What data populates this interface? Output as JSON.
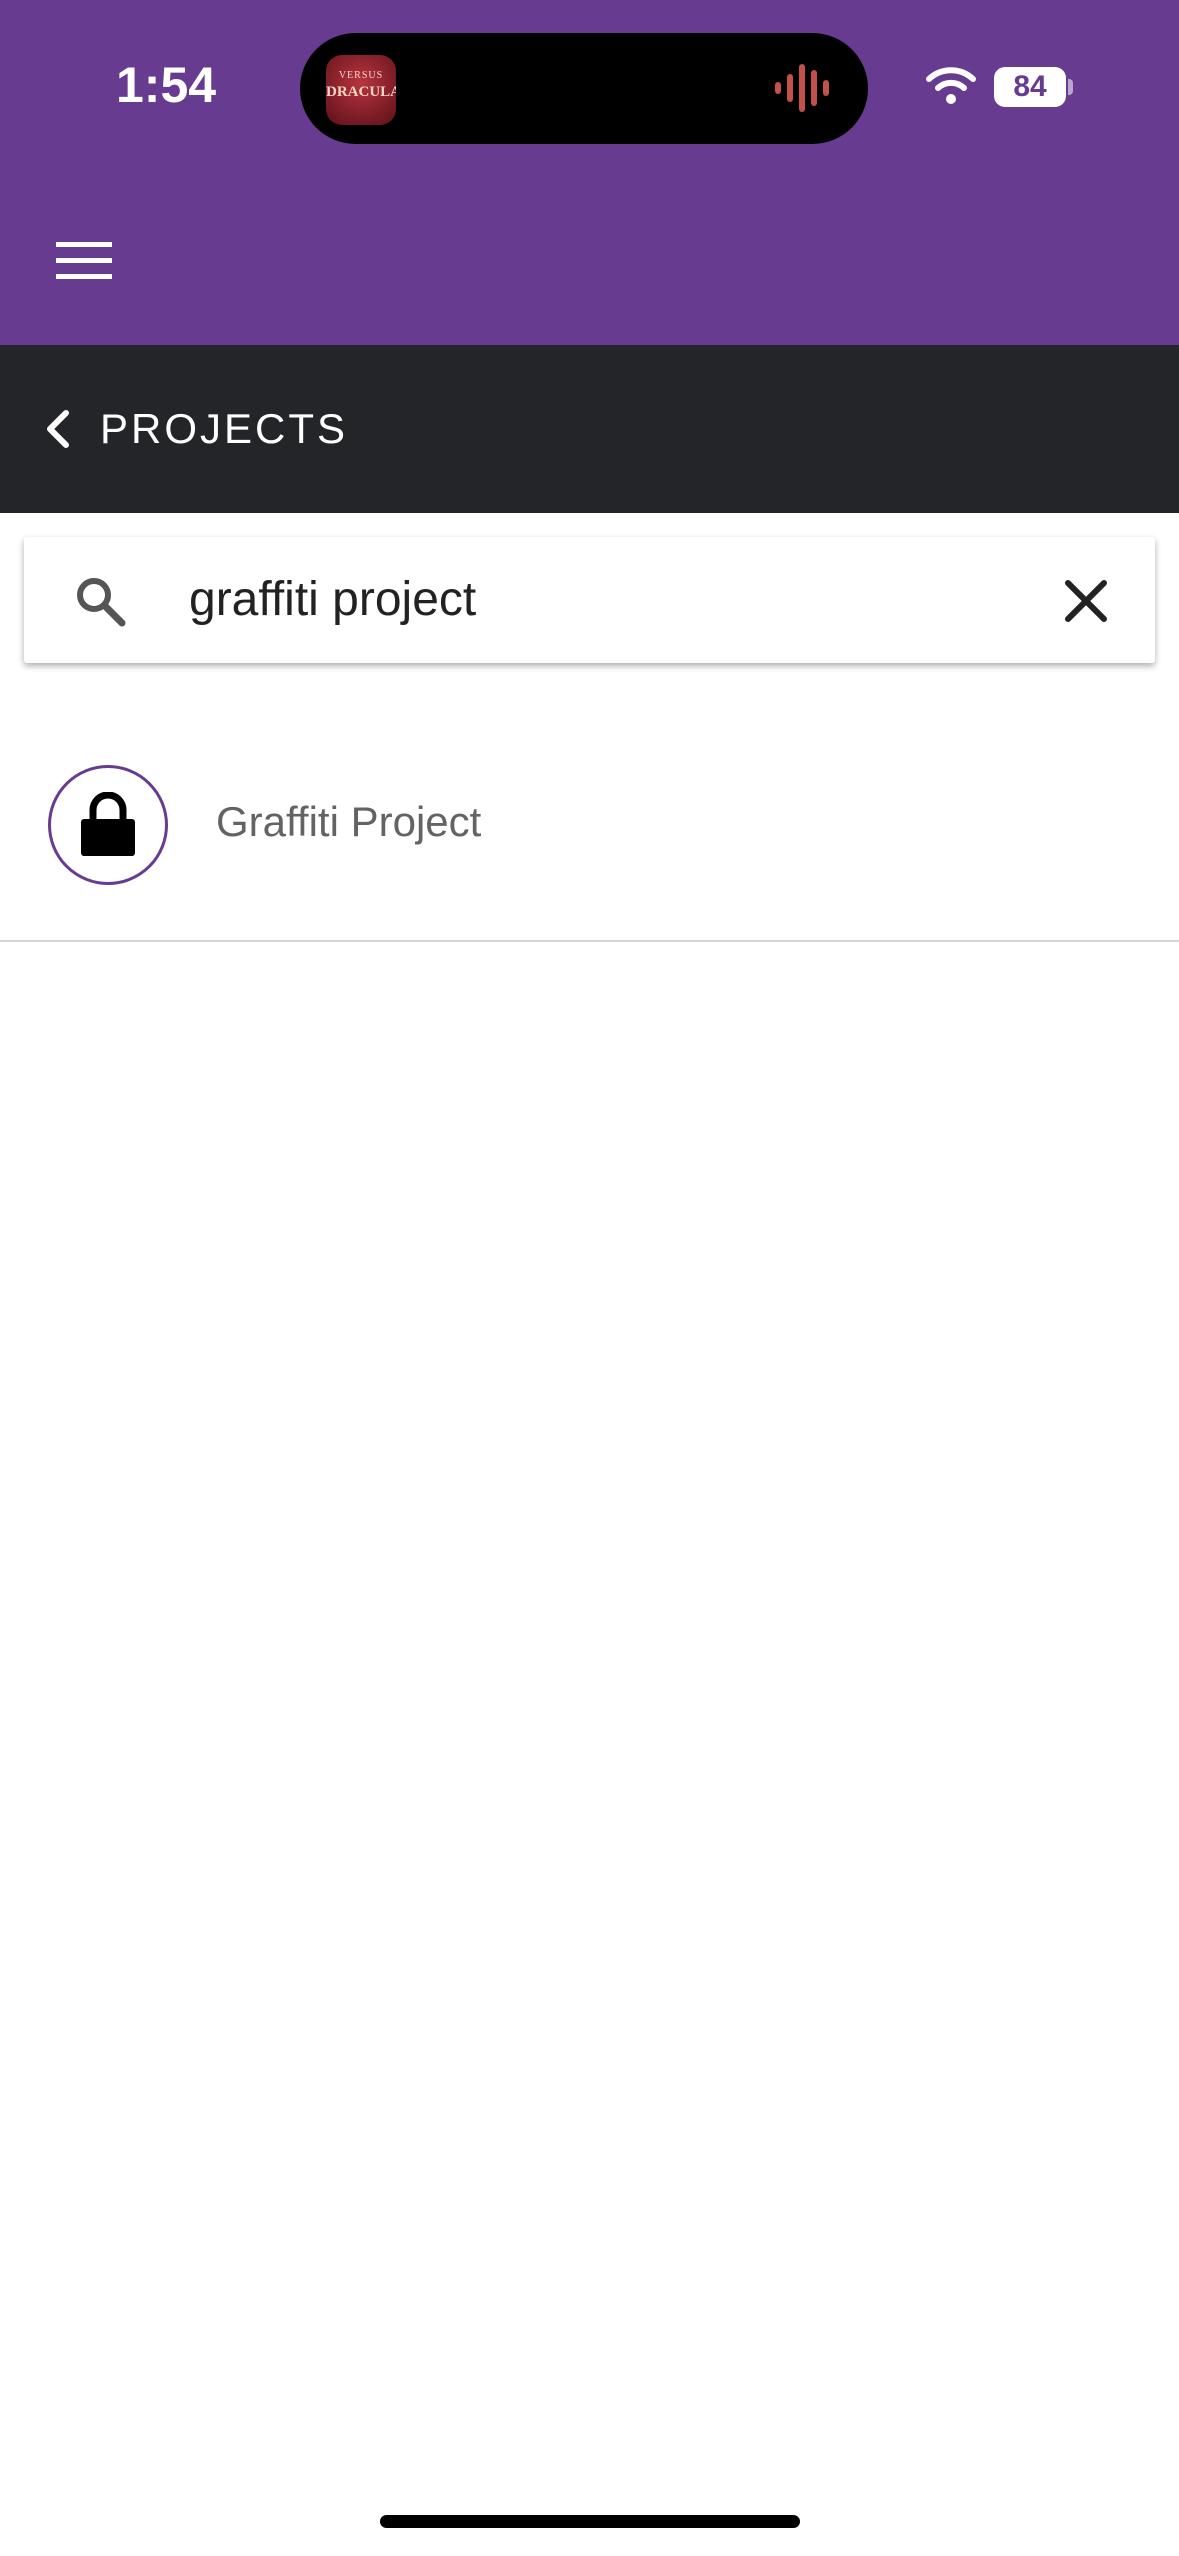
{
  "status_bar": {
    "time": "1:54",
    "battery": "84",
    "live_activity": {
      "app_icon_line1": "VERSUS",
      "app_icon_line2": "DRACULA"
    }
  },
  "app_bar": {
    "menu_icon": "hamburger-menu-icon",
    "color": "#673b90"
  },
  "sub_header": {
    "back_icon": "chevron-left-icon",
    "title": "PROJECTS",
    "color": "#242528"
  },
  "search": {
    "value": "graffiti project",
    "search_icon": "search-icon",
    "clear_icon": "close-icon"
  },
  "results": [
    {
      "icon": "lock-icon",
      "label": "Graffiti Project"
    }
  ]
}
